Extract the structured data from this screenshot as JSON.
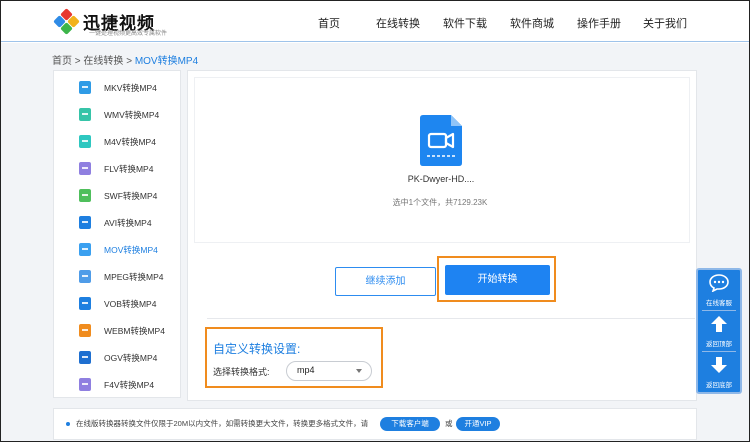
{
  "colors": {
    "accent": "#1e7fe0",
    "highlight": "#f08c1e",
    "header_rule": "#9fc3ea"
  },
  "logo": {
    "title": "迅捷视频",
    "subtitle": "一键处理视频更高效专属软件",
    "icon": "colored-diamonds-logo"
  },
  "nav": [
    {
      "label": "首页"
    },
    {
      "label": "在线转换"
    },
    {
      "label": "软件下载"
    },
    {
      "label": "软件商城"
    },
    {
      "label": "操作手册"
    },
    {
      "label": "关于我们"
    }
  ],
  "breadcrumb": {
    "home": "首页",
    "sep1": ">",
    "section": "在线转换",
    "sep2": ">",
    "current": "MOV转换MP4"
  },
  "sidebar": {
    "items": [
      {
        "label": "MKV转换MP4",
        "icon": "mkv-file-icon",
        "color": "#2f9be6",
        "badge": "MKV"
      },
      {
        "label": "WMV转换MP4",
        "icon": "wmv-file-icon",
        "color": "#36c4a8",
        "badge": "WMV"
      },
      {
        "label": "M4V转换MP4",
        "icon": "m4v-file-icon",
        "color": "#2ec7c0",
        "badge": "M4V"
      },
      {
        "label": "FLV转换MP4",
        "icon": "flv-file-icon",
        "color": "#8f7fe0",
        "badge": "FLV"
      },
      {
        "label": "SWF转换MP4",
        "icon": "swf-file-icon",
        "color": "#4fbf5c",
        "badge": "SWF"
      },
      {
        "label": "AVI转换MP4",
        "icon": "avi-file-icon",
        "color": "#1e7fe0",
        "badge": "AVI"
      },
      {
        "label": "MOV转换MP4",
        "icon": "mov-file-icon",
        "color": "#3aa0f0",
        "badge": "MOV",
        "active": true
      },
      {
        "label": "MPEG转换MP4",
        "icon": "mpeg-file-icon",
        "color": "#4f9ce8",
        "badge": "MPEG"
      },
      {
        "label": "VOB转换MP4",
        "icon": "vob-file-icon",
        "color": "#1e7fe0",
        "badge": "VOB"
      },
      {
        "label": "WEBM转换MP4",
        "icon": "webm-file-icon",
        "color": "#f08c1e",
        "badge": "WEBM"
      },
      {
        "label": "OGV转换MP4",
        "icon": "ogv-file-icon",
        "color": "#1e6fd0",
        "badge": "OGV"
      },
      {
        "label": "F4V转换MP4",
        "icon": "f4v-file-icon",
        "color": "#8f7fe0",
        "badge": "F4V"
      }
    ]
  },
  "upload": {
    "file_name": "PK-Dwyer-HD....",
    "file_info": "选中1个文件，共7129.23K",
    "icon": "video-file-icon"
  },
  "actions": {
    "add_label": "继续添加",
    "start_label": "开始转换"
  },
  "settings": {
    "title": "自定义转换设置:",
    "format_label": "选择转换格式:",
    "format_value": "mp4"
  },
  "notice": {
    "text": "在线版转换器转换文件仅限于20M以内文件，如需转换更大文件，转换更多格式文件，请",
    "download_label": "下载客户端",
    "or_label": "或",
    "vip_label": "开通VIP"
  },
  "float_bar": [
    {
      "label": "在线客服",
      "icon": "chat-bubble-icon"
    },
    {
      "label": "返回顶部",
      "icon": "arrow-up-icon"
    },
    {
      "label": "返回底部",
      "icon": "arrow-down-icon"
    }
  ]
}
